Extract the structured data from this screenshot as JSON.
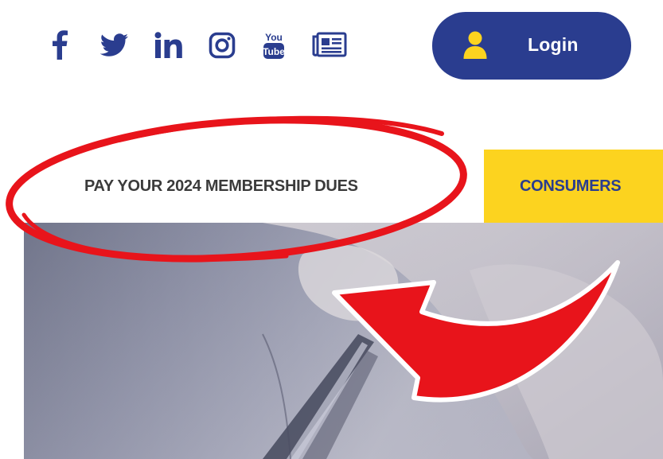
{
  "header": {
    "social_links": [
      {
        "name": "facebook",
        "glyph": "f"
      },
      {
        "name": "twitter",
        "glyph": "twitter-bird"
      },
      {
        "name": "linkedin",
        "glyph": "in"
      },
      {
        "name": "instagram",
        "glyph": "camera"
      },
      {
        "name": "youtube",
        "top": "You",
        "bottom": "Tube"
      },
      {
        "name": "newsletter",
        "glyph": "newspaper"
      }
    ],
    "login_label": "Login"
  },
  "nav": {
    "dues_label": "PAY YOUR 2024 MEMBERSHIP DUES",
    "consumers_label": "CONSUMERS"
  },
  "colors": {
    "brand_navy": "#2a3d8f",
    "accent_yellow": "#fcd31f",
    "annotation_red": "#e8141b"
  }
}
